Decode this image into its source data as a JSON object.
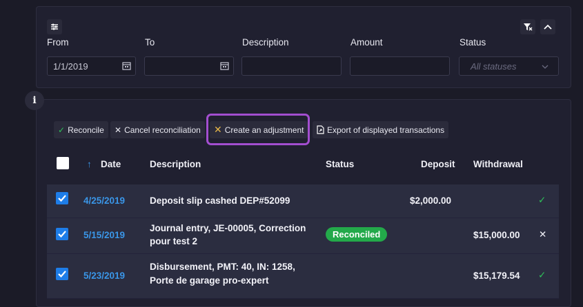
{
  "filters": {
    "from_label": "From",
    "to_label": "To",
    "description_label": "Description",
    "amount_label": "Amount",
    "status_label": "Status",
    "from_value": "1/1/2019",
    "status_placeholder": "All statuses"
  },
  "toolbar": {
    "reconcile": "Reconcile",
    "cancel_reconciliation": "Cancel reconciliation",
    "create_adjustment": "Create an adjustment",
    "export": "Export of displayed transactions"
  },
  "info_icon_text": "i",
  "table": {
    "headers": {
      "date": "Date",
      "description": "Description",
      "status": "Status",
      "deposit": "Deposit",
      "withdrawal": "Withdrawal"
    },
    "rows": [
      {
        "date": "4/25/2019",
        "description": "Deposit slip cashed DEP#52099",
        "status": "",
        "deposit": "$2,000.00",
        "withdrawal": "",
        "action": "✓"
      },
      {
        "date": "5/15/2019",
        "description_line1": "Journal entry, JE-00005, Correction",
        "description_line2": "pour test 2",
        "status": "Reconciled",
        "deposit": "",
        "withdrawal": "$15,000.00",
        "action": "✕"
      },
      {
        "date": "5/23/2019",
        "description_line1": "Disbursement, PMT: 40, IN: 1258,",
        "description_line2": "Porte de garage pro-expert",
        "status": "",
        "deposit": "",
        "withdrawal": "$15,179.54",
        "action": "✓"
      }
    ]
  },
  "colors": {
    "accent": "#3a96e8",
    "reconciled": "#23a94a",
    "highlight": "#a34ed0",
    "adjust_icon": "#e8b84a"
  }
}
